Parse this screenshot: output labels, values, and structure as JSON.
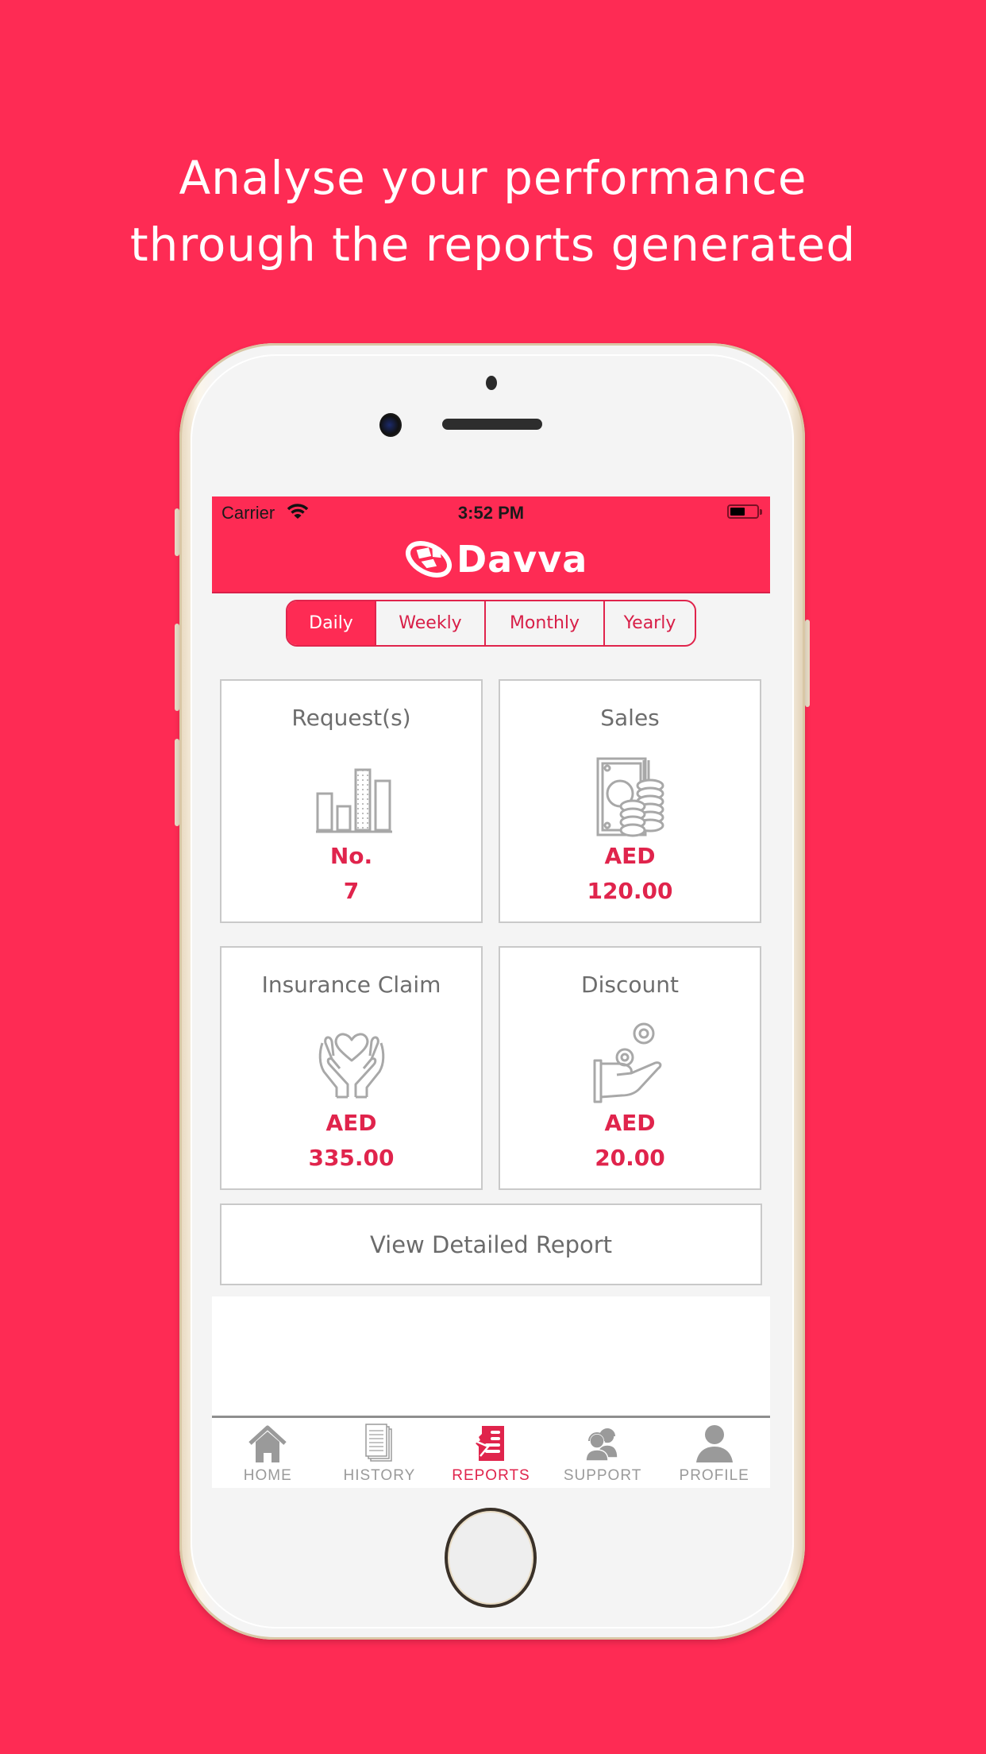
{
  "headline": {
    "line1": "Analyse your performance",
    "line2": "through the reports generated"
  },
  "colors": {
    "brand": "#fe2b54",
    "accent_text": "#e0244c",
    "muted": "#9a9a9a"
  },
  "status_bar": {
    "carrier": "Carrier",
    "time": "3:52 PM",
    "battery_level": 0.55
  },
  "header": {
    "logo_text": "Davva"
  },
  "period_tabs": [
    {
      "label": "Daily",
      "active": true
    },
    {
      "label": "Weekly",
      "active": false
    },
    {
      "label": "Monthly",
      "active": false
    },
    {
      "label": "Yearly",
      "active": false
    }
  ],
  "cards": [
    {
      "title": "Request(s)",
      "icon": "bar-chart-icon",
      "unit": "No.",
      "value": "7"
    },
    {
      "title": "Sales",
      "icon": "money-coins-icon",
      "unit": "AED",
      "value": "120.00"
    },
    {
      "title": "Insurance Claim",
      "icon": "hands-heart-icon",
      "unit": "AED",
      "value": "335.00"
    },
    {
      "title": "Discount",
      "icon": "hand-coins-icon",
      "unit": "AED",
      "value": "20.00"
    }
  ],
  "detail_button": {
    "label": "View Detailed Report"
  },
  "tab_bar": [
    {
      "label": "HOME",
      "icon": "home-icon",
      "active": false
    },
    {
      "label": "HISTORY",
      "icon": "documents-icon",
      "active": false
    },
    {
      "label": "REPORTS",
      "icon": "report-icon",
      "active": true
    },
    {
      "label": "SUPPORT",
      "icon": "support-agents-icon",
      "active": false
    },
    {
      "label": "PROFILE",
      "icon": "user-icon",
      "active": false
    }
  ]
}
